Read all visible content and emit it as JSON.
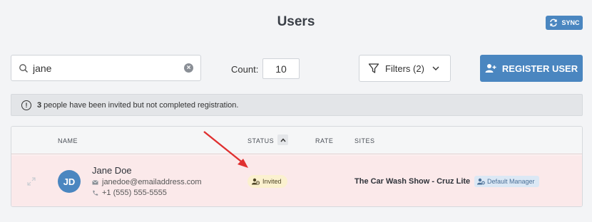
{
  "header": {
    "title": "Users",
    "sync_label": "SYNC"
  },
  "search": {
    "value": "jane",
    "placeholder": ""
  },
  "count": {
    "label": "Count:",
    "value": "10"
  },
  "filters": {
    "label": "Filters (2)"
  },
  "register": {
    "label": "REGISTER USER"
  },
  "notice": {
    "count": "3",
    "text": "people have been invited but not completed registration."
  },
  "table": {
    "columns": {
      "name": "NAME",
      "status": "STATUS",
      "rate": "RATE",
      "sites": "SITES"
    },
    "rows": [
      {
        "initials": "JD",
        "name": "Jane Doe",
        "email": "janedoe@emailaddress.com",
        "phone": "+1 (555) 555-5555",
        "status": "Invited",
        "rate": "",
        "site": "The Car Wash Show - Cruz Lite",
        "role": "Default Manager"
      }
    ]
  },
  "colors": {
    "accent": "#4a86c0",
    "invited_row_bg": "#fbe9ea",
    "invited_badge_bg": "#fbf1cf",
    "role_badge_bg": "#dbe8f5",
    "annotation_arrow": "#e03030"
  },
  "icons": [
    "sync-icon",
    "search-icon",
    "clear-icon",
    "filter-icon",
    "chevron-down-icon",
    "add-user-icon",
    "info-icon",
    "sort-up-icon",
    "expand-icon",
    "mail-icon",
    "phone-icon",
    "user-clock-icon",
    "user-cog-icon"
  ]
}
